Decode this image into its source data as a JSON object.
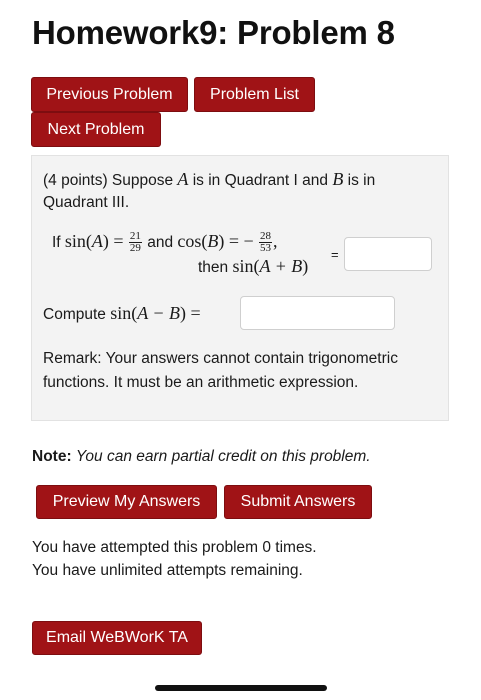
{
  "page_title": "Homework9: Problem 8",
  "nav": {
    "previous_label": "Previous Problem",
    "list_label": "Problem List",
    "next_label": "Next Problem"
  },
  "problem": {
    "intro_line1_a": "(4 points) Suppose ",
    "var_a": "A",
    "intro_line1_b": " is in Quadrant I and ",
    "var_b": "B",
    "intro_line1_c": " is in",
    "intro_line2": "Quadrant III.",
    "given_if": "If ",
    "sin_a": "sin(",
    "sin_a_close": ") =",
    "frac1_num": "21",
    "frac1_den": "29",
    "given_and": " and ",
    "cos_b": "cos(",
    "cos_b_close": ") = −",
    "frac2_num": "28",
    "frac2_den": "53",
    "comma": ",",
    "then_text": "then ",
    "sin_sum": "sin(",
    "sum_expr": "A + B",
    "sin_sum_close": ")",
    "equals_small": "=",
    "answer1_value": "",
    "compute_text": "Compute ",
    "sin_diff": "sin(",
    "diff_expr": "A − B",
    "sin_diff_close": ") =",
    "answer2_value": "",
    "remark_line1": "Remark: Your answers cannot contain trigonometric",
    "remark_line2": "functions. It must be an arithmetic expression."
  },
  "note": {
    "label": "Note:",
    "text": "You can earn partial credit on this problem."
  },
  "actions": {
    "preview_label": "Preview My Answers",
    "submit_label": "Submit Answers"
  },
  "status": {
    "attempts_line": "You have attempted this problem 0 times.",
    "remaining_line": "You have unlimited attempts remaining."
  },
  "email_label": "Email WeBWorK TA",
  "colors": {
    "button_bg": "#a01316",
    "button_text": "#ffffff",
    "problem_box_bg": "#f3f3f3"
  }
}
